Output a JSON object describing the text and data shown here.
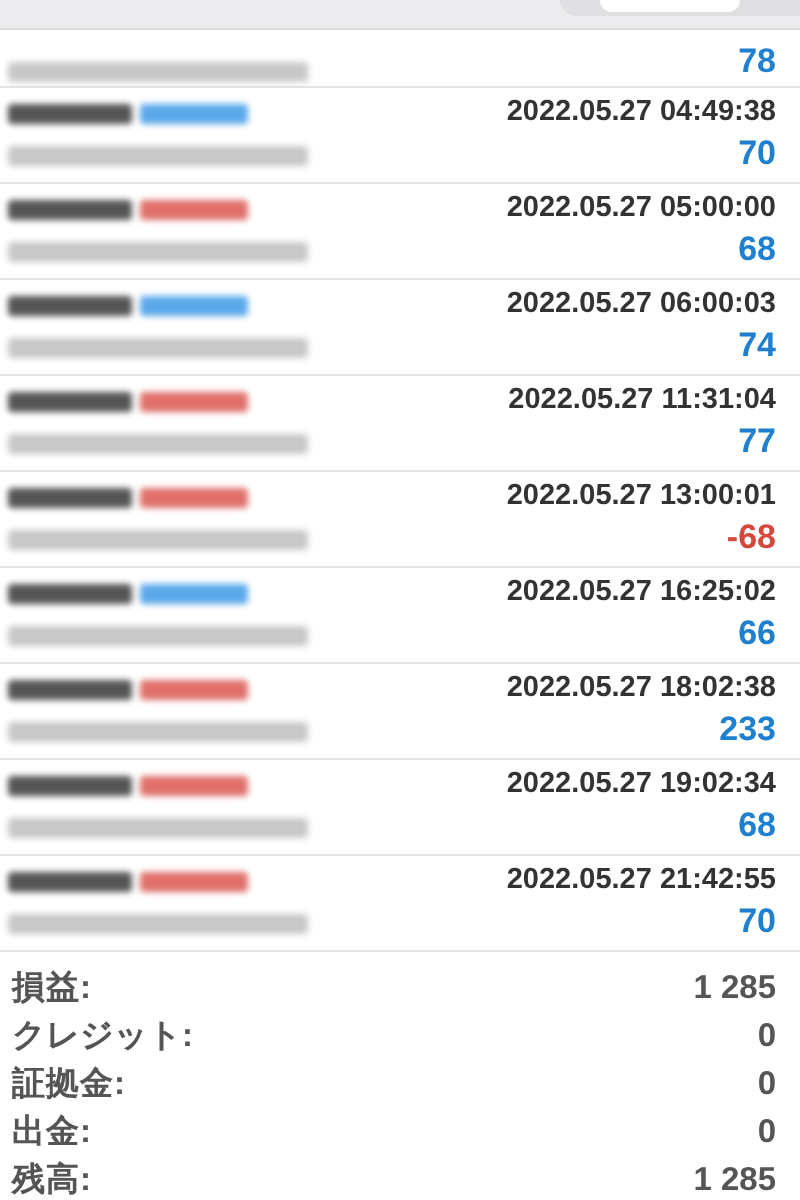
{
  "trades": [
    {
      "profit": "78",
      "loss": false
    },
    {
      "kind": "buy",
      "time": "2022.05.27 04:49:38",
      "profit": "70",
      "loss": false
    },
    {
      "kind": "sell",
      "time": "2022.05.27 05:00:00",
      "profit": "68",
      "loss": false
    },
    {
      "kind": "buy",
      "time": "2022.05.27 06:00:03",
      "profit": "74",
      "loss": false
    },
    {
      "kind": "sell",
      "time": "2022.05.27 11:31:04",
      "profit": "77",
      "loss": false
    },
    {
      "kind": "sell",
      "time": "2022.05.27 13:00:01",
      "profit": "-68",
      "loss": true
    },
    {
      "kind": "buy",
      "time": "2022.05.27 16:25:02",
      "profit": "66",
      "loss": false
    },
    {
      "kind": "sell",
      "time": "2022.05.27 18:02:38",
      "profit": "233",
      "loss": false
    },
    {
      "kind": "sell",
      "time": "2022.05.27 19:02:34",
      "profit": "68",
      "loss": false
    },
    {
      "kind": "sell",
      "time": "2022.05.27 21:42:55",
      "profit": "70",
      "loss": false
    }
  ],
  "summary": [
    {
      "label": "損益:",
      "value": "1 285"
    },
    {
      "label": "クレジット:",
      "value": "0"
    },
    {
      "label": "証拠金:",
      "value": "0"
    },
    {
      "label": "出金:",
      "value": "0"
    },
    {
      "label": "残高:",
      "value": "1 285"
    }
  ]
}
